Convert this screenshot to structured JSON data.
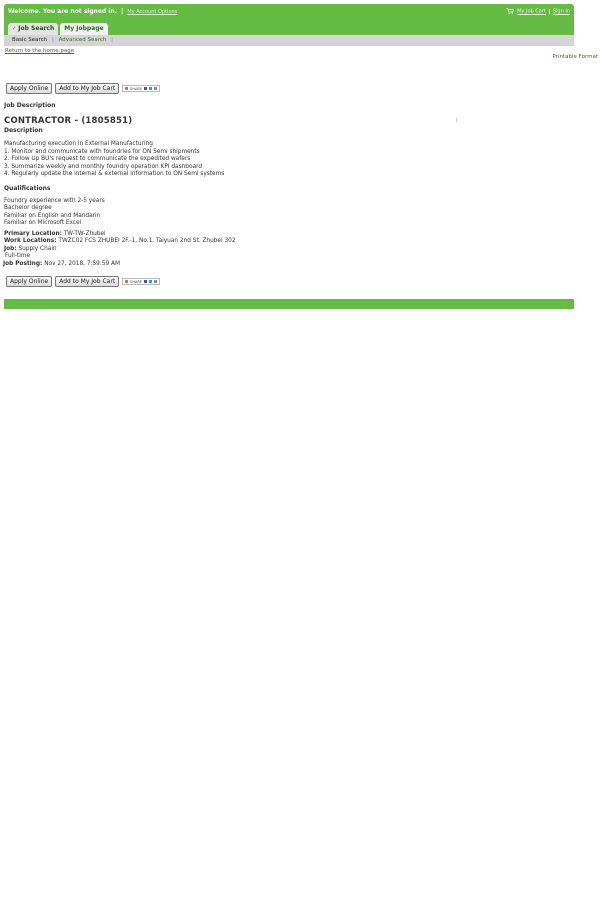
{
  "header": {
    "welcome": "Welcome. You are not signed in.",
    "account_options": "My Account Options",
    "cart_link": "My Job Cart",
    "sign_in": "Sign In"
  },
  "tabs": [
    {
      "label": "Job Search",
      "active": true
    },
    {
      "label": "My Jobpage",
      "active": false
    }
  ],
  "subnav": {
    "basic": "Basic Search",
    "advanced": "Advanced Search"
  },
  "links": {
    "home": "Return to the home page",
    "printable": "Printable Format"
  },
  "actions": {
    "apply": "Apply Online",
    "cart": "Add to My Job Cart",
    "share": "SHARE"
  },
  "job": {
    "section_heading": "Job Description",
    "title": "CONTRACTOR - (1805851)",
    "description_heading": "Description",
    "description_lines": [
      "Manufacturing execution in External Manufacturing",
      "1. Monitor and communicate with foundries for ON Semi shipments",
      "2. Follow Up BU's request to communicate the expedited wafers",
      "3. Summarize weekly and monthly foundry operation KPI dashboard",
      "4. Regularly update the internal & external information to ON Semi systems"
    ],
    "qualifications_heading": "Qualifications",
    "qualification_lines": [
      "Foundry experience with 2-5 years",
      "Bachelor degree",
      "Familiar on English and Mandarin",
      "Familiar on Microsoft Excel"
    ],
    "primary_location_label": "Primary Location:",
    "primary_location": "TW-TW-Zhubei",
    "work_locations_label": "Work Locations:",
    "work_locations": "TWZC02 FCS ZHUBEI 2F.-1, No.1, Taiyuan 2nd St.  Zhubei 302",
    "job_label": "Job:",
    "job": "Supply Chain",
    "schedule": "Full-time",
    "posting_label": "Job Posting:",
    "posting": "Nov 27, 2018, 7:59:59 AM"
  },
  "colors": {
    "brand_green": "#66bb44",
    "subnav_gray": "#d5d5d5"
  }
}
